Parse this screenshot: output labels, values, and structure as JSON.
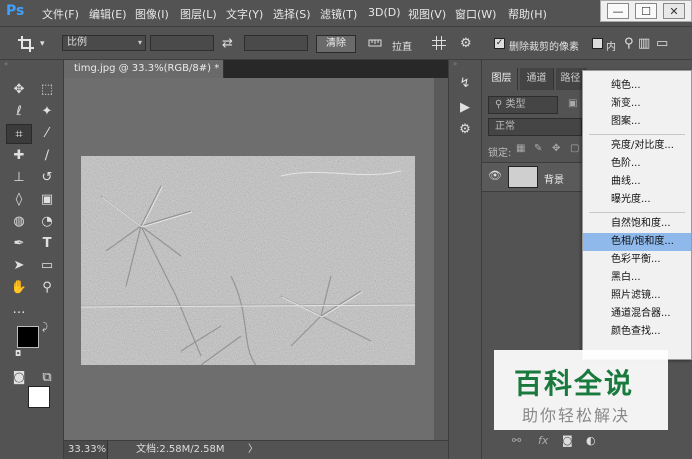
{
  "app": {
    "logo": "Ps"
  },
  "menu": [
    "文件(F)",
    "编辑(E)",
    "图像(I)",
    "图层(L)",
    "文字(Y)",
    "选择(S)",
    "滤镜(T)",
    "3D(D)",
    "视图(V)",
    "窗口(W)",
    "帮助(H)"
  ],
  "window_controls": {
    "minimize": "—",
    "maximize": "☐",
    "close": "✕"
  },
  "options": {
    "ratio": "比例",
    "clear": "清除",
    "straighten": "拉直",
    "delete_cropped": "删除裁剪的像素",
    "content": "内"
  },
  "document": {
    "tab": "timg.jpg @ 33.3%(RGB/8#) *",
    "tab_close": "×",
    "zoom": "33.33%",
    "doc_info": "文档:2.58M/2.58M",
    "status_arrow": "〉"
  },
  "panel": {
    "tabs": [
      "图层",
      "通道",
      "路径"
    ],
    "filter_kind": "类型",
    "blend_mode": "正常",
    "lock_label": "锁定:",
    "layer_name": "背景"
  },
  "context_menu": {
    "groups": [
      [
        "纯色...",
        "渐变...",
        "图案..."
      ],
      [
        "亮度/对比度...",
        "色阶...",
        "曲线...",
        "曝光度..."
      ],
      [
        "自然饱和度...",
        "色相/饱和度...",
        "色彩平衡...",
        "黑白...",
        "照片滤镜...",
        "通道混合器...",
        "颜色查找..."
      ]
    ],
    "highlighted": "色相/饱和度..."
  },
  "watermark": {
    "title": "百科全说",
    "subtitle": "助你轻松解决"
  },
  "colors": {
    "menu_highlight": "#8fb9ea",
    "ps_logo": "#3fa0ff",
    "watermark_title": "#1a7a3e"
  }
}
